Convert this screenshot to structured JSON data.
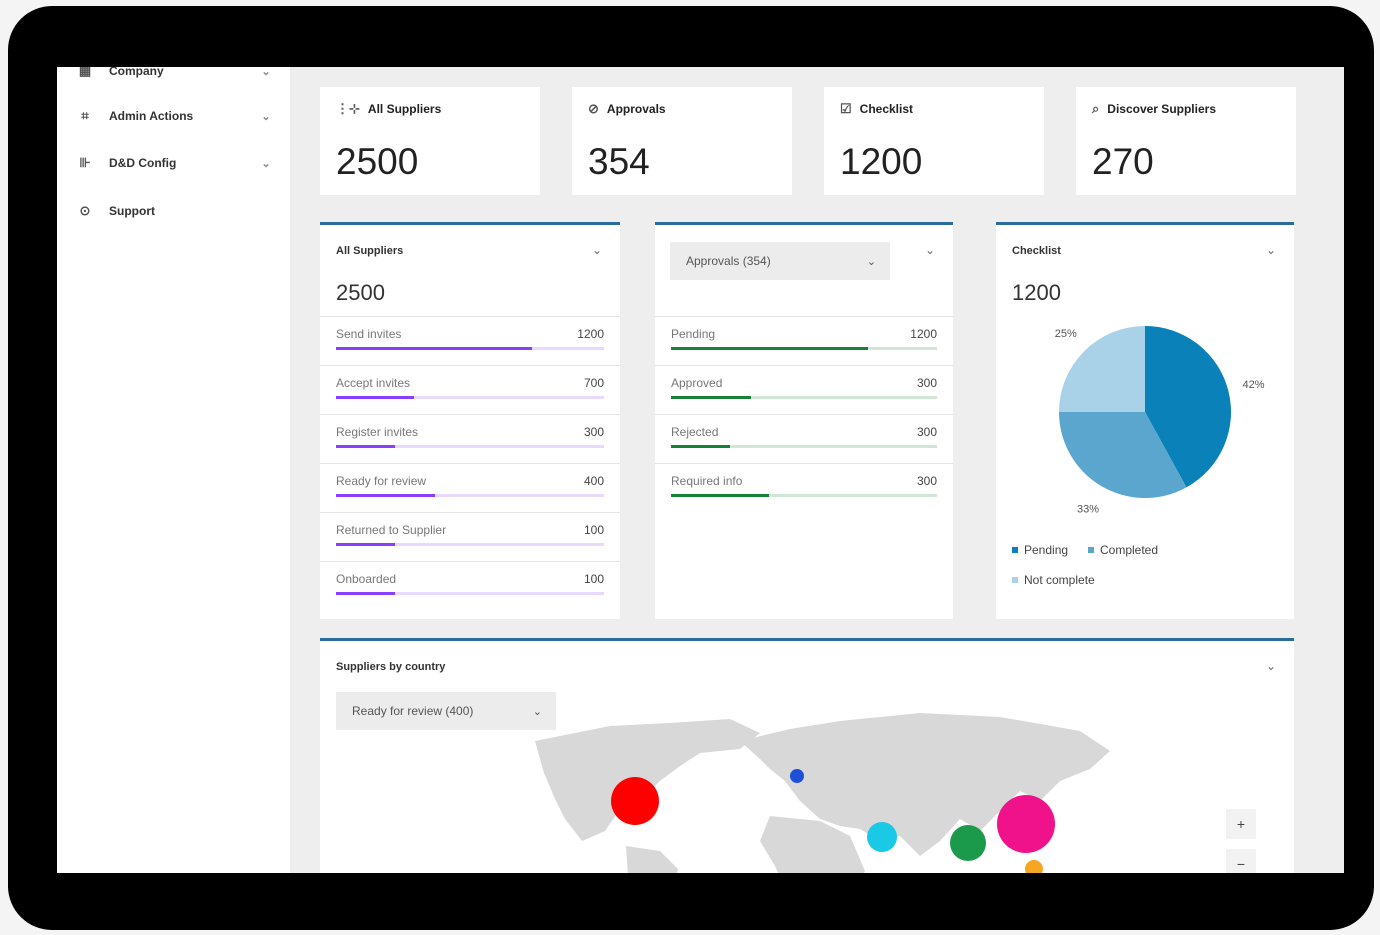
{
  "sidebar": {
    "items": [
      {
        "label": "Company",
        "icon": "building-icon",
        "has_chevron": true
      },
      {
        "label": "Admin Actions",
        "icon": "admin-icon",
        "has_chevron": true
      },
      {
        "label": "D&D Config",
        "icon": "config-icon",
        "has_chevron": true
      },
      {
        "label": "Support",
        "icon": "support-icon",
        "has_chevron": false
      }
    ]
  },
  "kpis": [
    {
      "label": "All Suppliers",
      "value": "2500",
      "icon": "suppliers-icon"
    },
    {
      "label": "Approvals",
      "value": "354",
      "icon": "approvals-icon"
    },
    {
      "label": "Checklist",
      "value": "1200",
      "icon": "checklist-icon"
    },
    {
      "label": "Discover Suppliers",
      "value": "270",
      "icon": "discover-icon"
    }
  ],
  "all_suppliers_panel": {
    "title": "All Suppliers",
    "total": "2500",
    "rows": [
      {
        "label": "Send invites",
        "value": "1200",
        "progress": 0.73
      },
      {
        "label": "Accept invites",
        "value": "700",
        "progress": 0.29
      },
      {
        "label": "Register invites",
        "value": "300",
        "progress": 0.22
      },
      {
        "label": "Ready for review",
        "value": "400",
        "progress": 0.37
      },
      {
        "label": "Returned to Supplier",
        "value": "100",
        "progress": 0.22
      },
      {
        "label": "Onboarded",
        "value": "100",
        "progress": 0.22
      }
    ],
    "accent": "#8a3ffc"
  },
  "approvals_panel": {
    "dropdown": "Approvals (354)",
    "rows": [
      {
        "label": "Pending",
        "value": "1200",
        "progress": 0.74
      },
      {
        "label": "Approved",
        "value": "300",
        "progress": 0.3
      },
      {
        "label": "Rejected",
        "value": "300",
        "progress": 0.22
      },
      {
        "label": "Required info",
        "value": "300",
        "progress": 0.37
      }
    ],
    "accent": "#198038"
  },
  "checklist_panel": {
    "title": "Checklist",
    "total": "1200",
    "chart_data": {
      "type": "pie",
      "slices": [
        {
          "name": "Pending",
          "value": 42,
          "label": "42%",
          "color": "#0a81b8"
        },
        {
          "name": "Completed",
          "value": 33,
          "label": "33%",
          "color": "#5aa6cf"
        },
        {
          "name": "Not complete",
          "value": 25,
          "label": "25%",
          "color": "#a9d1e8"
        }
      ],
      "legend_position": "bottom"
    }
  },
  "map_panel": {
    "title": "Suppliers by country",
    "dropdown": "Ready for review (400)",
    "zoom_in": "+",
    "zoom_out": "−",
    "bubbles": [
      {
        "name": "USA",
        "color": "#ff0000"
      },
      {
        "name": "France",
        "color": "#1d4fd8"
      },
      {
        "name": "Middle East",
        "color": "#19c9e6"
      },
      {
        "name": "India",
        "color": "#1b9a4b"
      },
      {
        "name": "China",
        "color": "#f0128a"
      },
      {
        "name": "Southeast Asia",
        "color": "#f5a623"
      }
    ]
  }
}
